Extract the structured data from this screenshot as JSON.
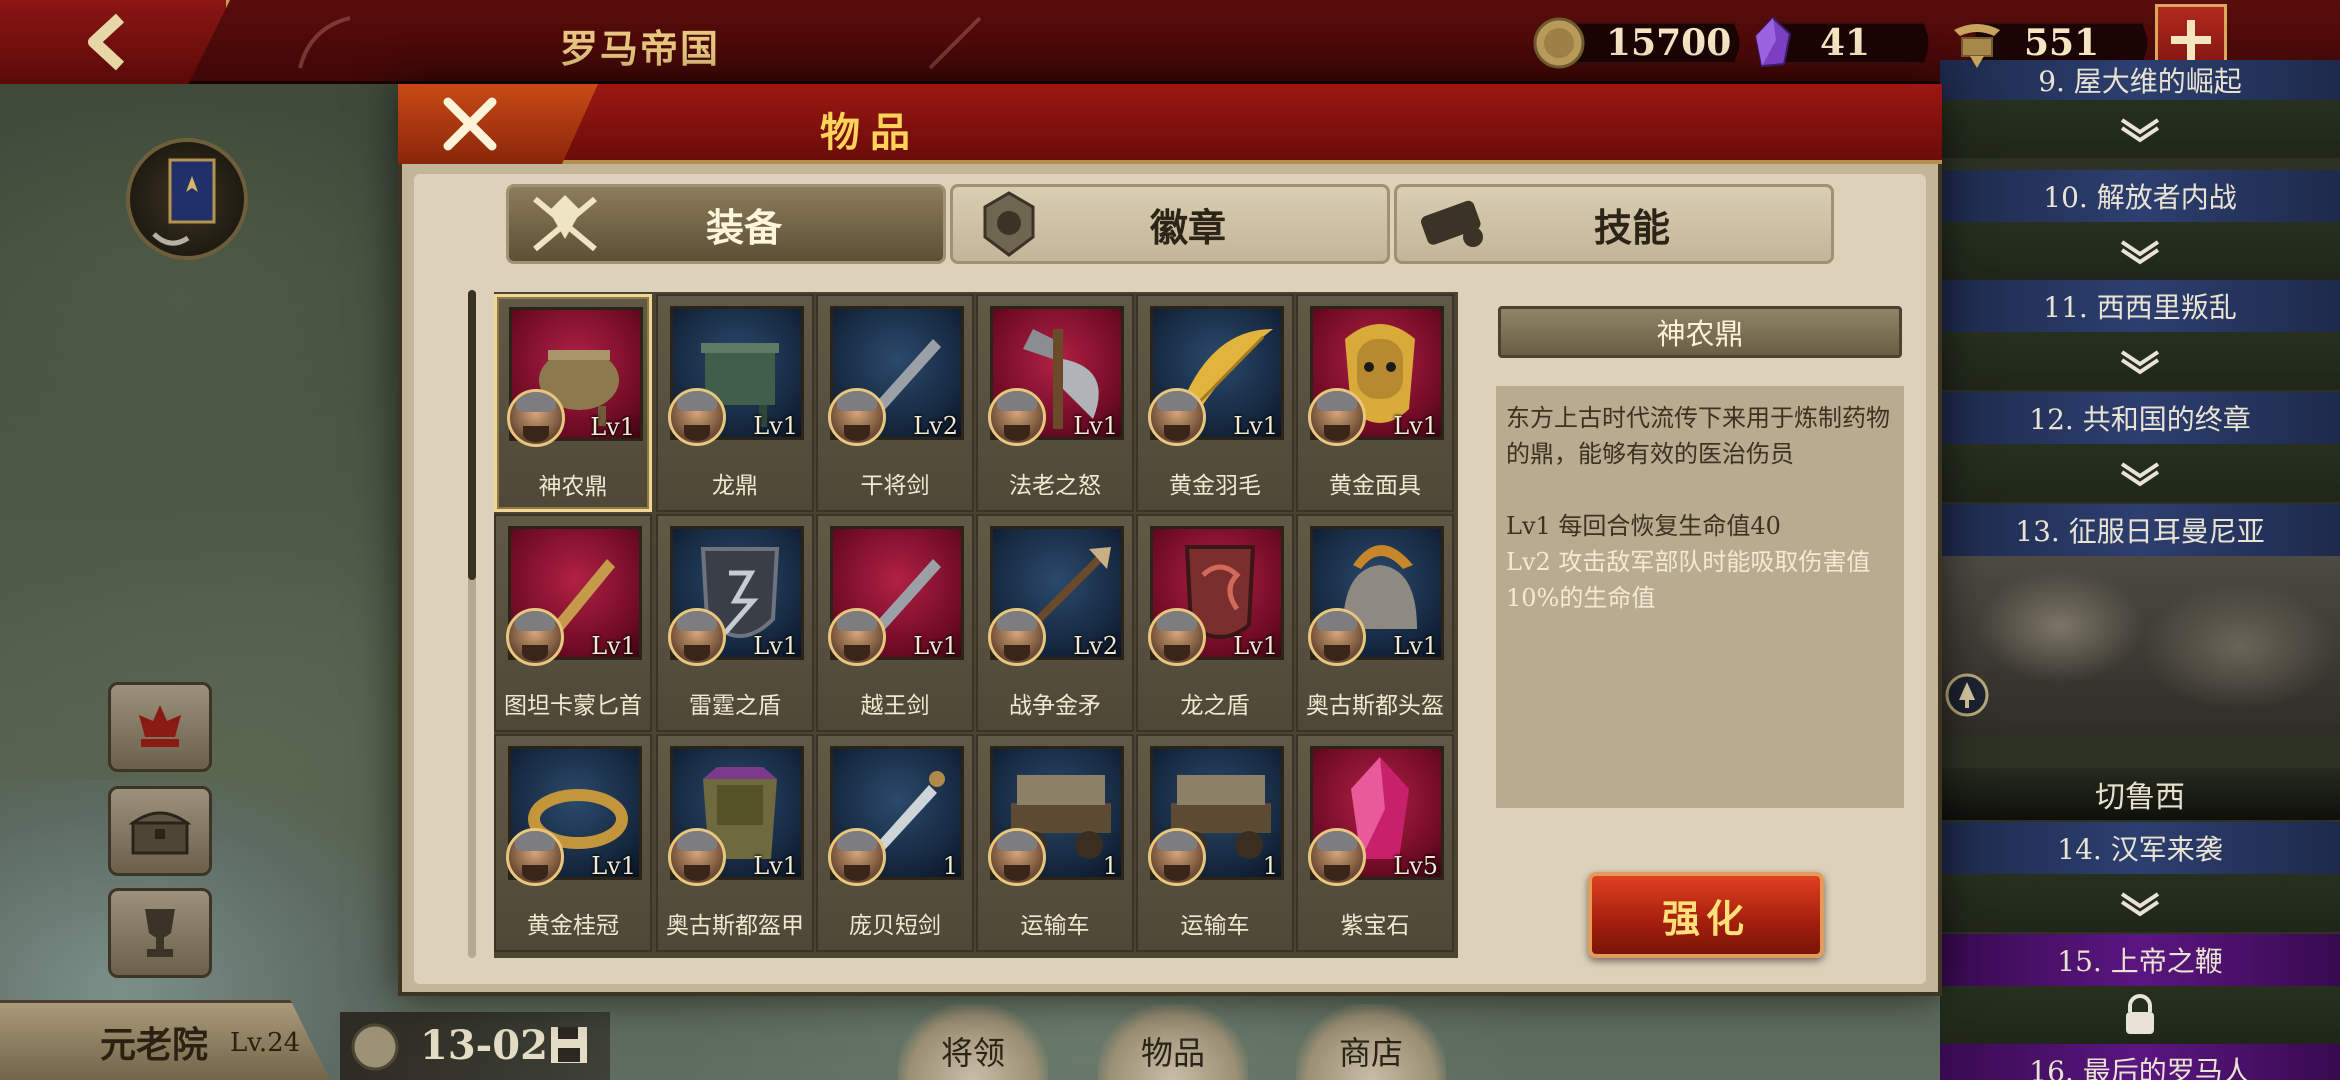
{
  "topbar": {
    "empire_name": "罗马帝国",
    "resources": {
      "coins": "15700",
      "gems": "41",
      "spqr": "551"
    }
  },
  "dialog": {
    "title": "物品",
    "tabs": [
      {
        "label": "装备",
        "active": true
      },
      {
        "label": "徽章",
        "active": false
      },
      {
        "label": "技能",
        "active": false
      }
    ],
    "items": [
      {
        "name": "神农鼎",
        "level": "Lv1",
        "art": "cauldron",
        "bg": "red"
      },
      {
        "name": "龙鼎",
        "level": "Lv1",
        "art": "dragon-cauldron",
        "bg": "blue"
      },
      {
        "name": "干将剑",
        "level": "Lv2",
        "art": "sword",
        "bg": "blue"
      },
      {
        "name": "法老之怒",
        "level": "Lv1",
        "art": "axe",
        "bg": "red"
      },
      {
        "name": "黄金羽毛",
        "level": "Lv1",
        "art": "feather",
        "bg": "blue"
      },
      {
        "name": "黄金面具",
        "level": "Lv1",
        "art": "mask",
        "bg": "red"
      },
      {
        "name": "图坦卡蒙匕首",
        "level": "Lv1",
        "art": "dagger",
        "bg": "red"
      },
      {
        "name": "雷霆之盾",
        "level": "Lv1",
        "art": "shield",
        "bg": "blue"
      },
      {
        "name": "越王剑",
        "level": "Lv1",
        "art": "sword",
        "bg": "red"
      },
      {
        "name": "战争金矛",
        "level": "Lv2",
        "art": "spear",
        "bg": "blue"
      },
      {
        "name": "龙之盾",
        "level": "Lv1",
        "art": "dragon-shield",
        "bg": "red"
      },
      {
        "name": "奥古斯都头盔",
        "level": "Lv1",
        "art": "helmet",
        "bg": "blue"
      },
      {
        "name": "黄金桂冠",
        "level": "Lv1",
        "art": "laurel",
        "bg": "blue"
      },
      {
        "name": "奥古斯都盔甲",
        "level": "Lv1",
        "art": "armor",
        "bg": "blue"
      },
      {
        "name": "庞贝短剑",
        "level": "1",
        "art": "gladius",
        "bg": "blue"
      },
      {
        "name": "运输车",
        "level": "1",
        "art": "cart",
        "bg": "blue"
      },
      {
        "name": "运输车",
        "level": "1",
        "art": "cart",
        "bg": "blue"
      },
      {
        "name": "紫宝石",
        "level": "Lv5",
        "art": "gem",
        "bg": "red"
      }
    ],
    "detail": {
      "title": "神农鼎",
      "description": "东方上古时代流传下来用于炼制药物的鼎，能够有效的医治伤员",
      "lv1": "Lv1  每回合恢复生命值40",
      "lv2": "Lv2  攻击敌军部队时能吸取伤害值10%的生命值"
    },
    "enhance_label": "强化"
  },
  "missions": {
    "partial_top": "9. 屋大维的崛起",
    "m10": "10. 解放者内战",
    "m11": "11. 西西里叛乱",
    "m12": "12. 共和国的终章",
    "m13": "13. 征服日耳曼尼亚",
    "m13_caption": "切鲁西",
    "m14": "14. 汉军来袭",
    "m15": "15. 上帝之鞭",
    "m16": "16. 最后的罗马人"
  },
  "bottom": {
    "senate": "元老院",
    "senate_level": "Lv.24",
    "turn": "13-02",
    "nav": [
      "将领",
      "物品",
      "商店"
    ]
  },
  "colors": {
    "header_red": "#6a0c09",
    "gold": "#ffd35a",
    "mission_blue": "#2d3f70",
    "mission_purple": "#5a1681"
  }
}
